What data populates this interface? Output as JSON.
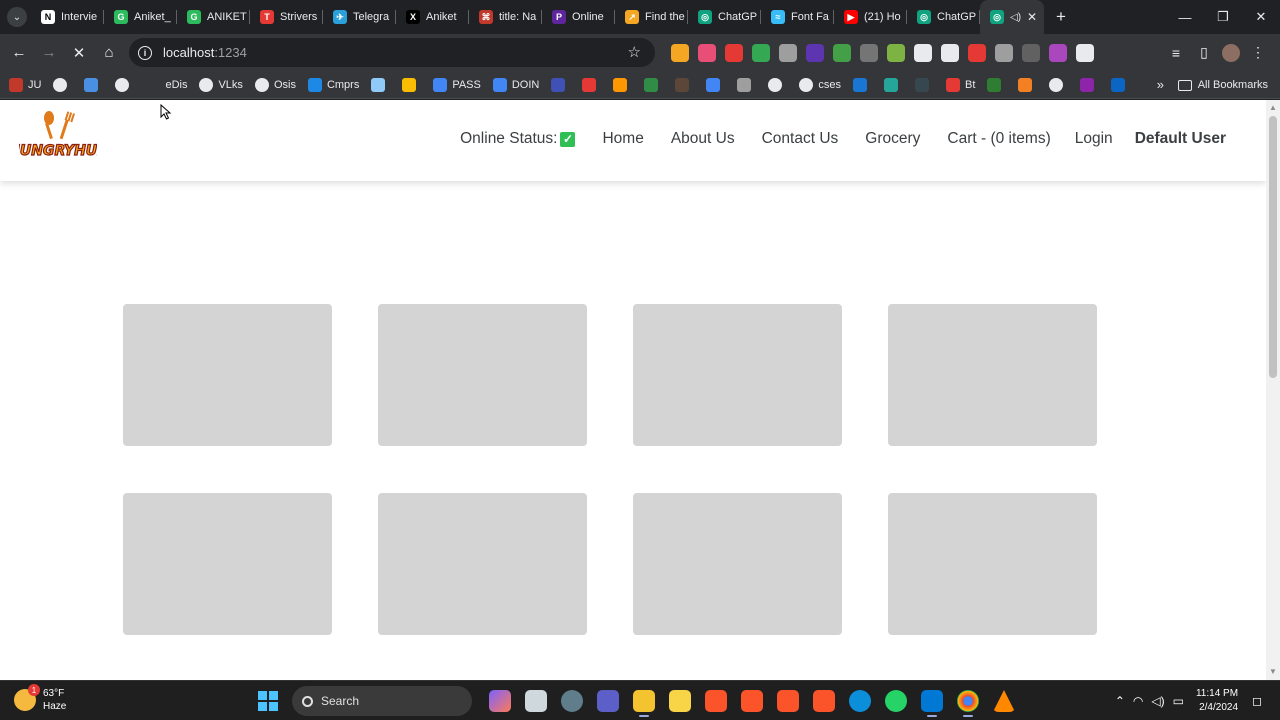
{
  "browser": {
    "tabs": [
      {
        "title": "Intervie",
        "icon": "notion-icon",
        "color": "#ffffff",
        "glyph": "N"
      },
      {
        "title": "Aniket_",
        "icon": "leetcode-icon",
        "color": "#2cbb5d",
        "glyph": "G"
      },
      {
        "title": "ANIKET",
        "icon": "leetcode-icon",
        "color": "#2cbb5d",
        "glyph": "G"
      },
      {
        "title": "Strivers",
        "icon": "tuf-icon",
        "color": "#e53935",
        "glyph": "T"
      },
      {
        "title": "Telegra",
        "icon": "telegram-icon",
        "color": "#2aa1da",
        "glyph": "✈"
      },
      {
        "title": "Aniket",
        "icon": "x-icon",
        "color": "#000000",
        "glyph": "X"
      },
      {
        "title": "title: Na",
        "icon": "pen-icon",
        "color": "#c0392b",
        "glyph": "⌘"
      },
      {
        "title": "Online",
        "icon": "phonepe-icon",
        "color": "#5f259f",
        "glyph": "P"
      },
      {
        "title": "Find the",
        "icon": "find-icon",
        "color": "#f5a623",
        "glyph": "↗"
      },
      {
        "title": "ChatGP",
        "icon": "chatgpt-icon",
        "color": "#10a37f",
        "glyph": "◎"
      },
      {
        "title": "Font Fa",
        "icon": "tailwind-icon",
        "color": "#38bdf8",
        "glyph": "≈"
      },
      {
        "title": "(21) Ho",
        "icon": "youtube-icon",
        "color": "#ff0000",
        "glyph": "▶"
      },
      {
        "title": "ChatGP",
        "icon": "chatgpt-icon",
        "color": "#10a37f",
        "glyph": "◎"
      }
    ],
    "active_tab": {
      "icon": "chatgpt-icon",
      "color": "#10a37f"
    },
    "url_host": "localhost",
    "url_port": ":1234",
    "bookmarks": [
      {
        "label": "JU",
        "icon": "ju-icon",
        "color": "#c0392b"
      },
      {
        "label": "",
        "icon": "globe-icon",
        "color": "#e8eaed"
      },
      {
        "label": "",
        "icon": "cube-icon",
        "color": "#4a90e2"
      },
      {
        "label": "",
        "icon": "notion-icon",
        "color": "#e8eaed"
      },
      {
        "label": "eDis",
        "icon": "a-icon",
        "color": "#35363a"
      },
      {
        "label": "VLks",
        "icon": "globe-icon",
        "color": "#e8eaed"
      },
      {
        "label": "Osis",
        "icon": "globe-icon",
        "color": "#e8eaed"
      },
      {
        "label": "Cmprs",
        "icon": "compress-icon",
        "color": "#1e88e5"
      },
      {
        "label": "",
        "icon": "photo-icon",
        "color": "#90caf9"
      },
      {
        "label": "",
        "icon": "drive-icon",
        "color": "#fbbc04"
      },
      {
        "label": "PASS",
        "icon": "doc-icon",
        "color": "#4285f4"
      },
      {
        "label": "DOIN",
        "icon": "doc-icon",
        "color": "#4285f4"
      },
      {
        "label": "",
        "icon": "hex-icon",
        "color": "#3f51b5"
      },
      {
        "label": "",
        "icon": "c-icon",
        "color": "#e53935"
      },
      {
        "label": "",
        "icon": "diamond-icon",
        "color": "#ff9800"
      },
      {
        "label": "",
        "icon": "gfg-icon",
        "color": "#2f8d46"
      },
      {
        "label": "",
        "icon": "cc-icon",
        "color": "#5b4638"
      },
      {
        "label": "",
        "icon": "chart-icon",
        "color": "#4285f4"
      },
      {
        "label": "",
        "icon": "dash-icon",
        "color": "#9e9e9e"
      },
      {
        "label": "",
        "icon": "globe-icon",
        "color": "#e8eaed"
      },
      {
        "label": "cses",
        "icon": "globe-icon",
        "color": "#e8eaed"
      },
      {
        "label": "",
        "icon": "shield-icon",
        "color": "#1976d2"
      },
      {
        "label": "",
        "icon": "mountain-icon",
        "color": "#26a69a"
      },
      {
        "label": "",
        "icon": "ai-icon",
        "color": "#37474f"
      },
      {
        "label": "Bt",
        "icon": "s-icon",
        "color": "#e53935"
      },
      {
        "label": "",
        "icon": "w-icon",
        "color": "#2e7d32"
      },
      {
        "label": "",
        "icon": "stack-icon",
        "color": "#f48024"
      },
      {
        "label": "",
        "icon": "github-icon",
        "color": "#e8eaed"
      },
      {
        "label": "",
        "icon": "u-icon",
        "color": "#8e24aa"
      },
      {
        "label": "",
        "icon": "linkedin-icon",
        "color": "#0a66c2"
      }
    ],
    "all_bookmarks_label": "All Bookmarks",
    "extension_colors": [
      "#f5a623",
      "#e94e77",
      "#e53935",
      "#34a853",
      "#9e9e9e",
      "#5e35b1",
      "#43a047",
      "#757575",
      "#7cb342",
      "#e8eaed",
      "#e8eaed",
      "#e53935",
      "#9e9e9e",
      "#616161",
      "#ab47bc",
      "#e8eaed"
    ]
  },
  "app": {
    "logo_text": "HUNGRYHUB",
    "nav": {
      "online_status_label": "Online Status:",
      "home": "Home",
      "about": "About Us",
      "contact": "Contact Us",
      "grocery": "Grocery",
      "cart": "Cart - (0 items)",
      "login": "Login",
      "user": "Default User"
    },
    "shimmer_cards": 8
  },
  "taskbar": {
    "weather_temp": "63°F",
    "weather_desc": "Haze",
    "weather_badge": "1",
    "search_label": "Search",
    "time": "11:14 PM",
    "date": "2/4/2024"
  }
}
